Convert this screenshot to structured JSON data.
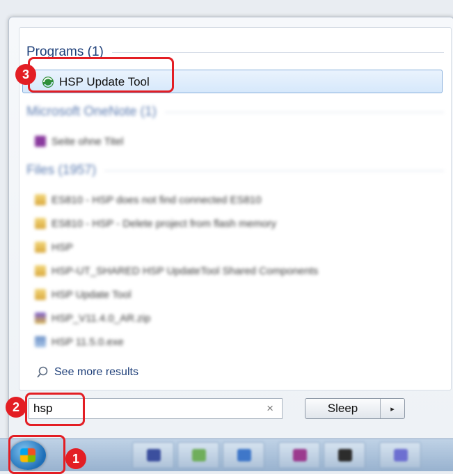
{
  "start_menu": {
    "programs_header": "Programs (1)",
    "selected_program": {
      "label": "HSP Update Tool",
      "icon": "hsp-update-tool-icon"
    },
    "onenote_header": "Microsoft OneNote (1)",
    "onenote_items": [
      {
        "label": "Seite ohne Titel",
        "icon": "onenote-page-icon"
      }
    ],
    "files_header": "Files (1957)",
    "files": [
      {
        "label": "ES810 - HSP does not find connected ES810",
        "icon": "folder-icon"
      },
      {
        "label": "ES810 - HSP - Delete project from flash memory",
        "icon": "folder-icon"
      },
      {
        "label": "HSP",
        "icon": "folder-icon"
      },
      {
        "label": "HSP-UT_SHARED HSP UpdateTool Shared Components",
        "icon": "folder-icon"
      },
      {
        "label": "HSP Update Tool",
        "icon": "folder-icon"
      },
      {
        "label": "HSP_V11.4.0_AR.zip",
        "icon": "zip-icon"
      },
      {
        "label": "HSP 11.5.0.exe",
        "icon": "exe-icon"
      }
    ],
    "see_more": "See more results",
    "search": {
      "value": "hsp",
      "clear": "×"
    },
    "sleep_label": "Sleep",
    "sleep_arrow": "▸"
  },
  "callouts": [
    "1",
    "2",
    "3"
  ],
  "colors": {
    "callout": "#e31e24",
    "link": "#1e3f79",
    "selection_border": "#86aedb"
  }
}
